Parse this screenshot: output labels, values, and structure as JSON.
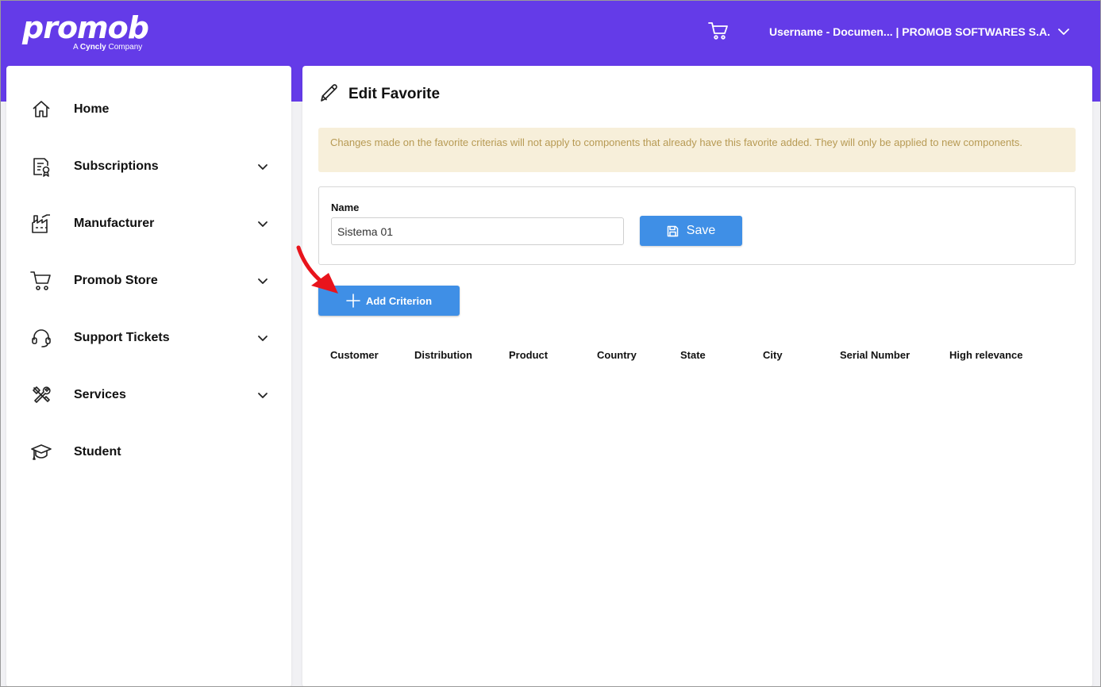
{
  "header": {
    "logo_text": "promob",
    "logo_sub_prefix": "A ",
    "logo_sub_brand": "Cyncly",
    "logo_sub_suffix": " Company",
    "cart_icon": "cart-icon",
    "user_label": "Username - Documen... | PROMOB SOFTWARES S.A.",
    "background_color": "#643be8"
  },
  "sidebar": {
    "items": [
      {
        "label": "Home",
        "icon": "home-icon",
        "has_submenu": false
      },
      {
        "label": "Subscriptions",
        "icon": "certificate-icon",
        "has_submenu": true
      },
      {
        "label": "Manufacturer",
        "icon": "factory-icon",
        "has_submenu": true
      },
      {
        "label": "Promob Store",
        "icon": "cart-icon",
        "has_submenu": true
      },
      {
        "label": "Support Tickets",
        "icon": "headset-icon",
        "has_submenu": true
      },
      {
        "label": "Services",
        "icon": "tools-icon",
        "has_submenu": true
      },
      {
        "label": "Student",
        "icon": "graduation-cap-icon",
        "has_submenu": false
      }
    ]
  },
  "main": {
    "title": "Edit Favorite",
    "notice": "Changes made on the favorite criterias will not apply to components that already have this favorite added. They will only be applied to new components.",
    "form": {
      "name_label": "Name",
      "name_value": "Sistema 01",
      "save_label": "Save"
    },
    "add_criterion_label": "Add Criterion",
    "columns": [
      "Customer",
      "Distribution",
      "Product",
      "Country",
      "State",
      "City",
      "Serial Number",
      "High relevance"
    ]
  },
  "colors": {
    "accent": "#643be8",
    "button": "#3f8fe6",
    "notice_bg": "#f7efda",
    "notice_text": "#b79a54",
    "annotation_arrow": "#e8141c"
  }
}
